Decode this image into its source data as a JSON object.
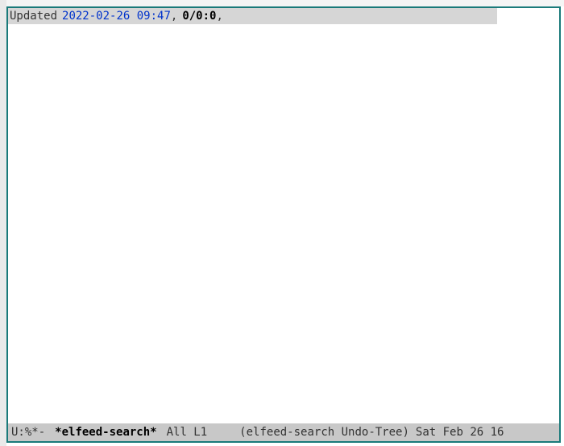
{
  "header": {
    "updated_label": "Updated",
    "timestamp": "2022-02-26 09:47",
    "comma1": ",",
    "counts": "0/0:0",
    "comma2": ","
  },
  "modeline": {
    "status": "U:%*-",
    "buffer_name": "*elfeed-search*",
    "position": "All L1",
    "modes": "(elfeed-search Undo-Tree)",
    "datetime": "Sat Feb 26 16"
  }
}
